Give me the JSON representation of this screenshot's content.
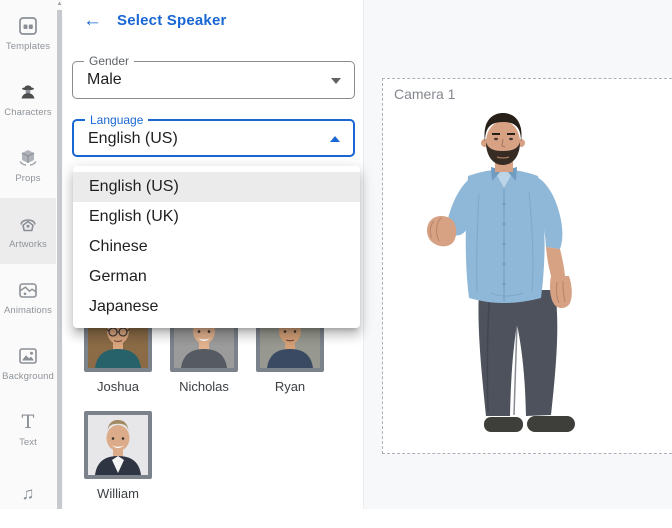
{
  "sidebar": {
    "selected_item": "Artworks",
    "items": [
      {
        "label": "Templates"
      },
      {
        "label": "Characters"
      },
      {
        "label": "Props"
      },
      {
        "label": "Artworks"
      },
      {
        "label": "Animations"
      },
      {
        "label": "Background"
      },
      {
        "label": "Text"
      },
      {
        "label": ""
      }
    ]
  },
  "speaker_panel": {
    "back_icon": "←",
    "title": "Select Speaker",
    "gender_field": {
      "label": "Gender",
      "value": "Male"
    },
    "language_field": {
      "label": "Language",
      "value": "English (US)"
    },
    "language_menu": {
      "selected_option": "English (US)",
      "options": [
        "English (US)",
        "English (UK)",
        "Chinese",
        "German",
        "Japanese"
      ]
    },
    "speakers": [
      {
        "name": "Joshua"
      },
      {
        "name": "Nicholas"
      },
      {
        "name": "Ryan"
      },
      {
        "name": "William"
      }
    ]
  },
  "canvas": {
    "camera_label": "Camera 1"
  },
  "colors": {
    "accent_blue": "#1967d2",
    "canvas_bg": "#f7f8f9",
    "selected_row_bg": "#ebebeb",
    "character": {
      "hair": "#262019",
      "beard": "#362c24",
      "skin": "#d7a184",
      "skin_shade": "#a8775d",
      "shirt": "#8fb8d8",
      "shirt_shade": "#6f9cc0",
      "undershirt": "#bcd4e6",
      "pants": "#4d525c",
      "pants_shade": "#3b404a",
      "shoes": "#3e3f3b"
    },
    "avatars": {
      "joshua": {
        "bg": "#8a6b46",
        "hair": "#4a3a28",
        "skin": "#d9a57e",
        "shirt": "#27616a"
      },
      "nicholas": {
        "bg": "#9b9b9b",
        "hair": "#c9a55c",
        "skin": "#e2b28e",
        "shirt": "#565b63"
      },
      "ryan": {
        "bg": "#97988f",
        "hair": "#6b5135",
        "skin": "#d3a078",
        "shirt": "#3b4a63"
      },
      "william": {
        "bg": "#e7e7ea",
        "hair": "#a18a63",
        "skin": "#dcab8a",
        "shirt": "#2e3442"
      }
    }
  }
}
